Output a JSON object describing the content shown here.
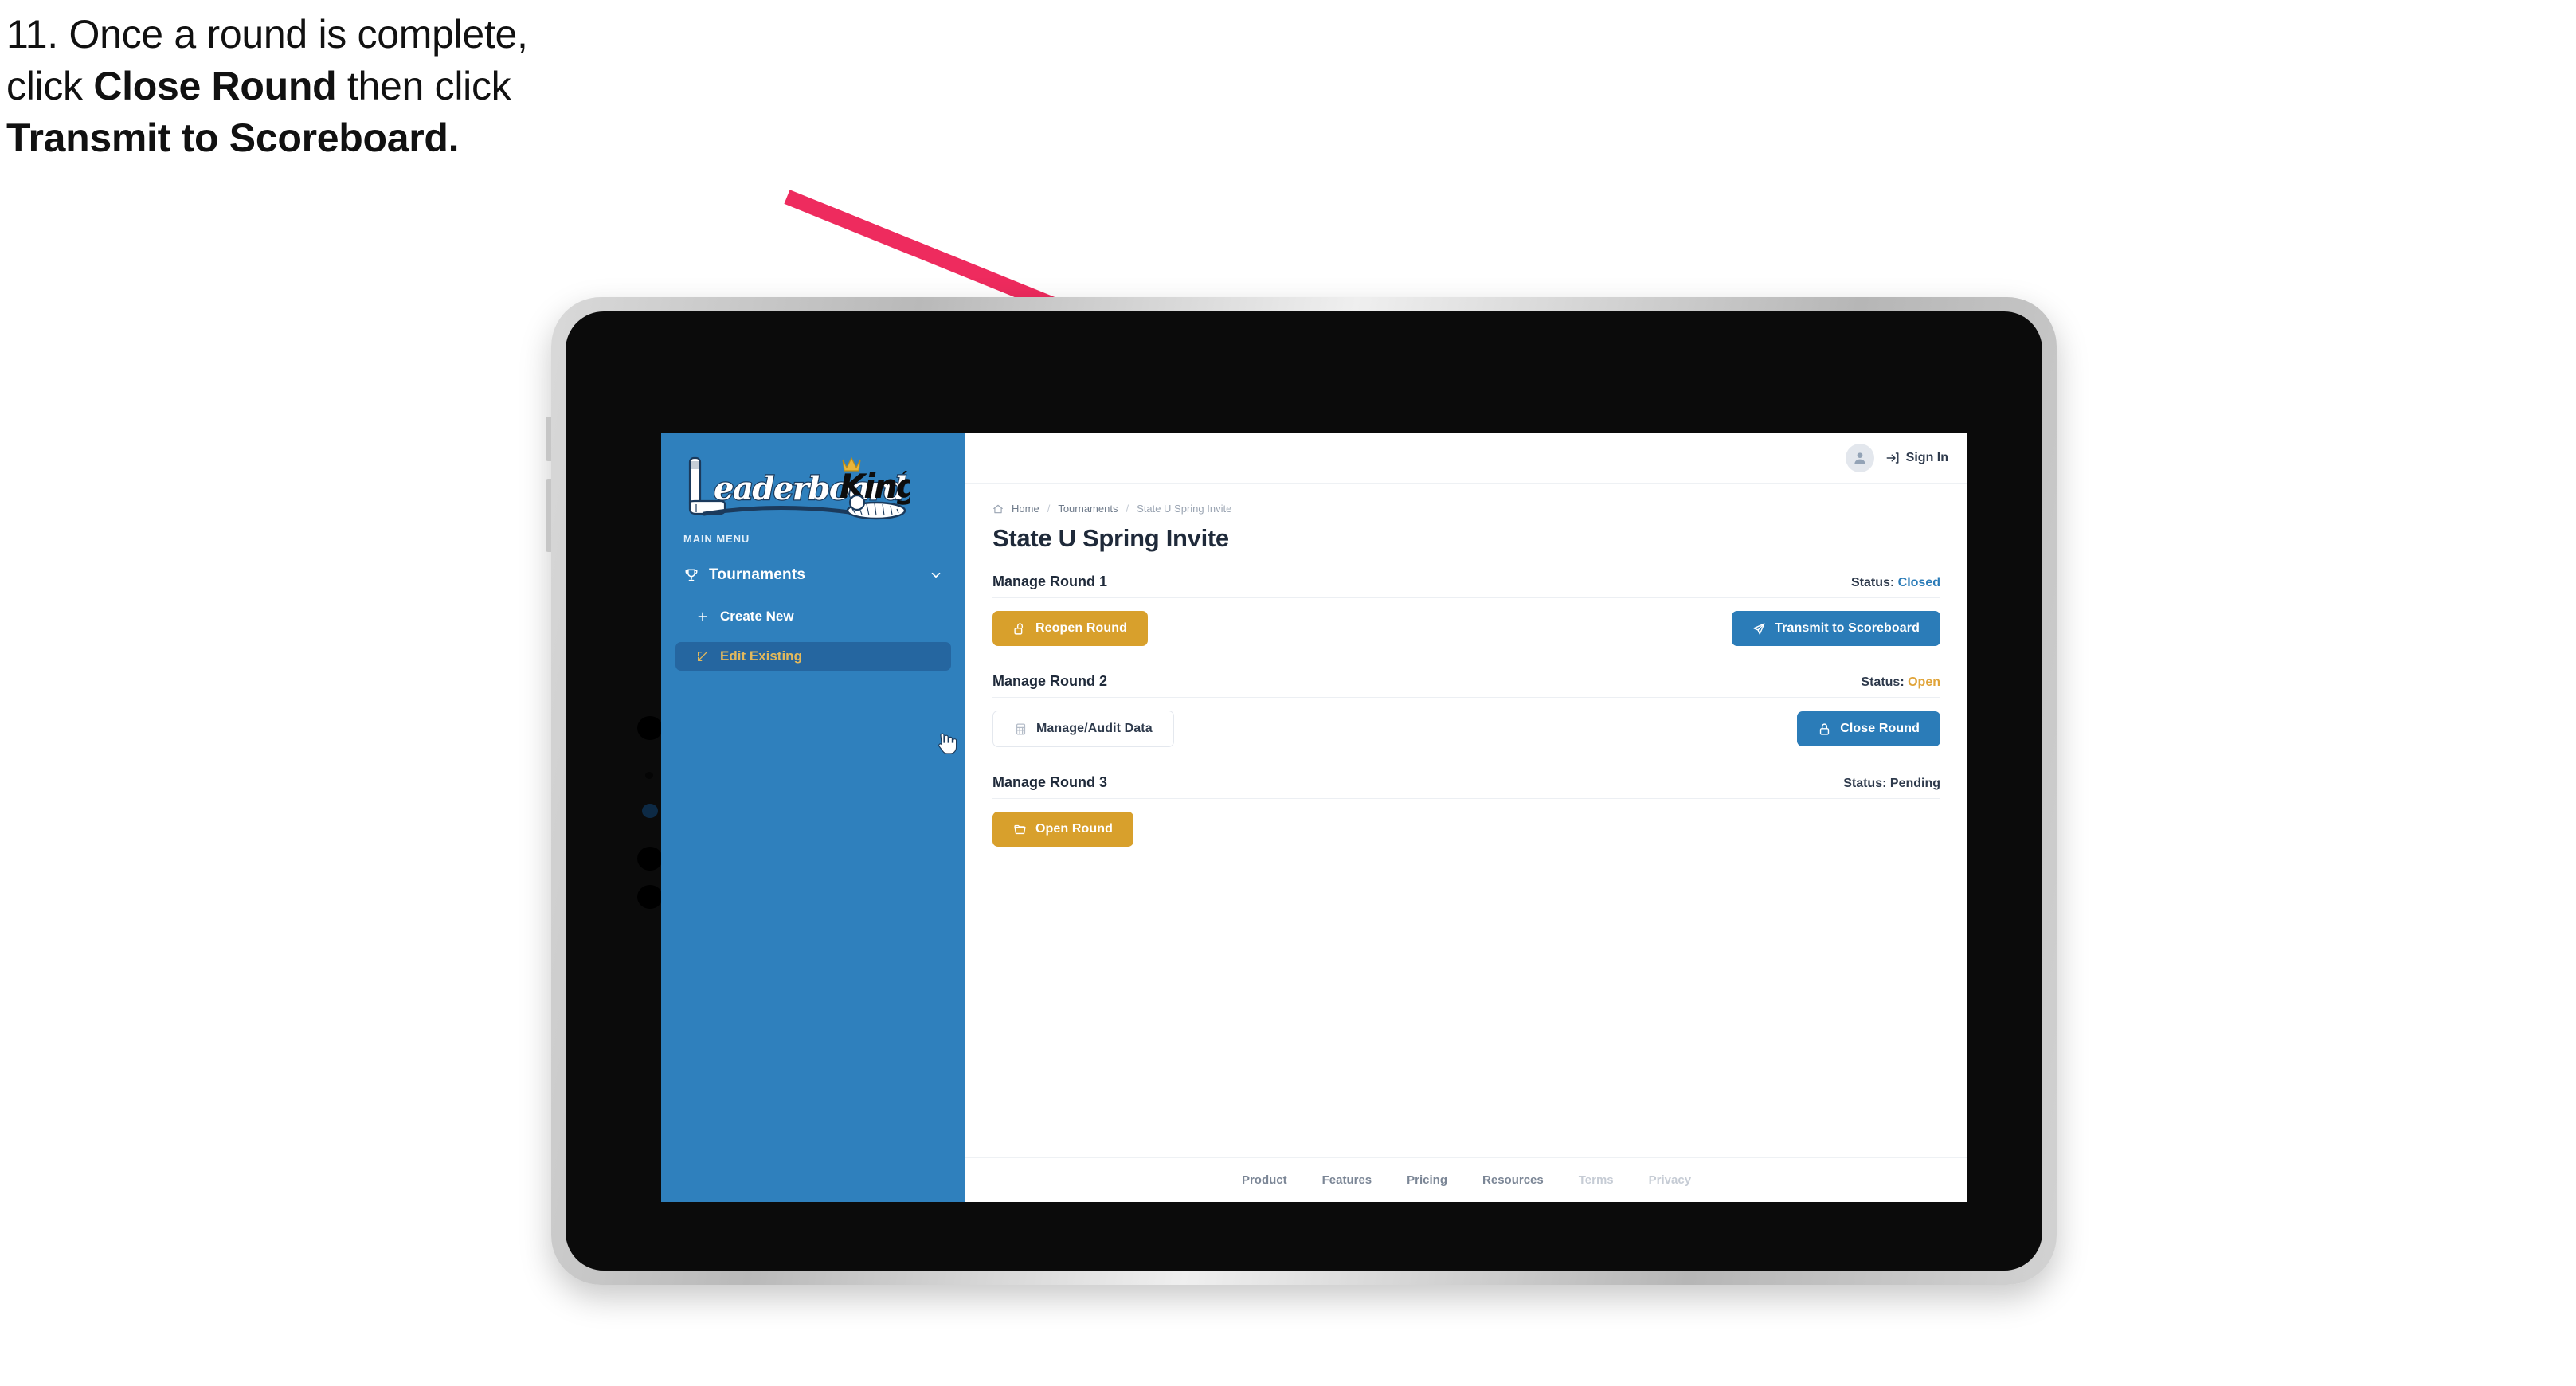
{
  "instruction": {
    "line1": "11. Once a round is complete,",
    "line2_pre": "click ",
    "line2_bold": "Close Round",
    "line2_post": " then click",
    "line3_bold": "Transmit to Scoreboard."
  },
  "annotation": {
    "arrow_color": "#ee2b5e",
    "points_to": "Transmit to Scoreboard"
  },
  "sidebar": {
    "logo": {
      "word1": "Leaderboard",
      "word2": "King"
    },
    "section_label": "MAIN MENU",
    "items": [
      {
        "label": "Tournaments",
        "icon": "trophy-icon",
        "chevron": "chevron-down-icon",
        "active": false
      },
      {
        "label": "Create New",
        "icon": "plus-icon",
        "active": false
      },
      {
        "label": "Edit Existing",
        "icon": "edit-square-icon",
        "active": true
      }
    ],
    "bg_color": "#2f80bd",
    "active_color": "#e3b95c"
  },
  "topbar": {
    "signin_label": "Sign In",
    "avatar_icon": "user-avatar-icon",
    "signin_icon": "login-arrow-icon"
  },
  "breadcrumb": {
    "home": "Home",
    "level2": "Tournaments",
    "current": "State U Spring Invite",
    "separator": "/"
  },
  "page": {
    "title": "State U Spring Invite"
  },
  "rounds": [
    {
      "title": "Manage Round 1",
      "status_label": "Status:",
      "status_value": "Closed",
      "status_color": "#2b7cb8",
      "left_button": {
        "label": "Reopen Round",
        "icon": "unlock-icon",
        "style": "gold"
      },
      "right_button": {
        "label": "Transmit to Scoreboard",
        "icon": "send-plane-icon",
        "style": "blue"
      }
    },
    {
      "title": "Manage Round 2",
      "status_label": "Status:",
      "status_value": "Open",
      "status_color": "#e0a43a",
      "left_button": {
        "label": "Manage/Audit Data",
        "icon": "table-grid-icon",
        "style": "ghost"
      },
      "right_button": {
        "label": "Close Round",
        "icon": "lock-icon",
        "style": "blue"
      }
    },
    {
      "title": "Manage Round 3",
      "status_label": "Status:",
      "status_value": "Pending",
      "status_color": "#2e3a4c",
      "left_button": {
        "label": "Open Round",
        "icon": "folder-open-icon",
        "style": "gold"
      },
      "right_button": null
    }
  ],
  "footer": {
    "links": [
      {
        "label": "Product",
        "dim": false
      },
      {
        "label": "Features",
        "dim": false
      },
      {
        "label": "Pricing",
        "dim": false
      },
      {
        "label": "Resources",
        "dim": false
      },
      {
        "label": "Terms",
        "dim": true
      },
      {
        "label": "Privacy",
        "dim": true
      }
    ]
  }
}
